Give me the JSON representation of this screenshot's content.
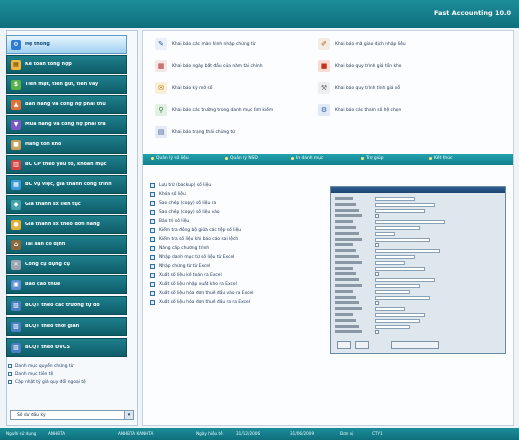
{
  "app": {
    "title": "Fast Accounting 10.0"
  },
  "sidebar": {
    "items": [
      {
        "label": "Hệ thống",
        "icon": "system-icon",
        "active": true
      },
      {
        "label": "Kế toán tổng hợp",
        "icon": "general-ledger-icon"
      },
      {
        "label": "Tiền mặt, tiền gửi, tiền vay",
        "icon": "cash-icon"
      },
      {
        "label": "Bán hàng và công nợ phải thu",
        "icon": "sales-icon"
      },
      {
        "label": "Mua hàng và công nợ phải trả",
        "icon": "purchase-icon"
      },
      {
        "label": "Hàng tồn kho",
        "icon": "inventory-icon"
      },
      {
        "label": "BC CP theo yếu tố, khoản mục",
        "icon": "cost-report-icon"
      },
      {
        "label": "BC vụ việc, giá thành công trình",
        "icon": "project-report-icon"
      },
      {
        "label": "Giá thành sx liên tục",
        "icon": "continuous-costing-icon"
      },
      {
        "label": "Giá thành sx theo đơn hàng",
        "icon": "order-costing-icon"
      },
      {
        "label": "Tài sản cố định",
        "icon": "fixed-asset-icon"
      },
      {
        "label": "Công cụ dụng cụ",
        "icon": "tools-icon"
      },
      {
        "label": "Báo cáo thuế",
        "icon": "tax-report-icon"
      },
      {
        "label": "BCQT theo các trường tự do",
        "icon": "custom-report-icon"
      },
      {
        "label": "BCQT theo thời gian",
        "icon": "time-report-icon"
      },
      {
        "label": "BCQT theo ĐVCS",
        "icon": "unit-report-icon"
      }
    ],
    "subitems": [
      {
        "label": "Danh mục quyển chứng từ"
      },
      {
        "label": "Danh mục tiền tệ"
      },
      {
        "label": "Cập nhật tỷ giá quy đổi ngoại tệ"
      }
    ],
    "combo": {
      "value": "Số dư đầu kỳ"
    }
  },
  "shortcuts": {
    "left": [
      {
        "label": "Khai báo các màn hình nhập chứng từ",
        "icon": "document-edit-icon"
      },
      {
        "label": "Khai báo ngày bắt đầu của năm tài chính",
        "icon": "calendar-icon"
      },
      {
        "label": "Khai báo kỳ mở sổ",
        "icon": "book-open-icon"
      },
      {
        "label": "Khai báo các trường trong danh mục tìm kiếm",
        "icon": "search-field-icon"
      },
      {
        "label": "Khai báo trạng thái chứng từ",
        "icon": "status-doc-icon"
      }
    ],
    "right": [
      {
        "label": "Khai báo mã giao dịch nhập liệu",
        "icon": "transaction-code-icon"
      },
      {
        "label": "Khai báo quy trình giá tồn kho",
        "icon": "inventory-cost-icon"
      },
      {
        "label": "Khai báo quy trình tính giá xổ",
        "icon": "pricing-process-icon"
      },
      {
        "label": "Khai báo các tham số hệ chọn",
        "icon": "parameters-icon"
      }
    ]
  },
  "tabs": [
    {
      "label": "Quản lý số liệu"
    },
    {
      "label": "Quản lý NSD"
    },
    {
      "label": "In danh mục"
    },
    {
      "label": "Trợ giúp"
    },
    {
      "label": "Kết thúc"
    }
  ],
  "functions": [
    "Lưu trữ (backup) số liệu",
    "Khóa số liệu",
    "Sao chép (copy) số liệu ra",
    "Sao chép (copy) số liệu vào",
    "Bảo trì số liệu",
    "Kiểm tra đồng bộ giữa các tệp số liệu",
    "Kiểm tra số liệu khi báo cáo sai lệch",
    "Nâng cấp chương trình",
    "Nhập danh mục từ số liệu từ Excel",
    "Nhập chứng từ từ Excel",
    "Xuất số liệu kế toán ra Excel",
    "Xuất số liệu nhập xuất kho ra Excel",
    "Xuất số liệu hóa đơn thuế đầu vào ra Excel",
    "Xuất số liệu hóa đơn thuế đầu ra ra Excel"
  ],
  "status": {
    "user_label": "Người sử dụng",
    "user_value": "ANHBTA",
    "user_name": "ANHBTA KANHTA",
    "date_label": "Ngày hiệu tê",
    "date_value": "31/12/2006",
    "date2": "31/06/2009",
    "unit_label": "Đơn vị",
    "unit_value": "CTY1"
  },
  "colors": {
    "teal": "#13808c",
    "teal_dark": "#0e5d69",
    "accent_yellow": "#ffe97a"
  }
}
